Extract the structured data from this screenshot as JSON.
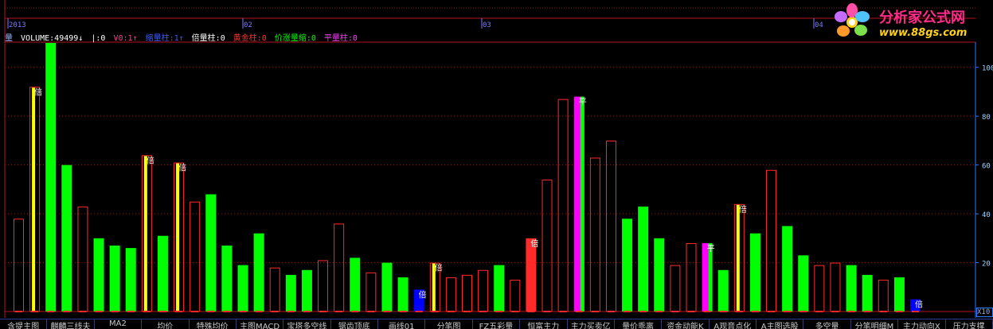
{
  "timeline": [
    {
      "label": "2013"
    },
    {
      "label": "02"
    },
    {
      "label": "03"
    },
    {
      "label": "04"
    }
  ],
  "indicator": {
    "name": "量",
    "volume": "VOLUME:49499↓",
    "sep": "|:0",
    "v0": "V0:1↑",
    "shrink": "缩量柱:1↑",
    "double": "倍量柱:0",
    "gold": "黄金柱:0",
    "rise_shrink": "价涨量缩:0",
    "flat": "平量柱:0"
  },
  "logo": {
    "title": "分析家公式网",
    "url": "www.88gs.com"
  },
  "scale_tag": "X10",
  "tabs": [
    "含提主图",
    "麒麟三线夫",
    "MA2",
    "均价",
    "特殊均价",
    "主图MACD",
    "宝塔多空线",
    "锯齿顶底",
    "画线01",
    "分笔图",
    "FZ五彩量",
    "恒富主力",
    "主力买卖亿",
    "量价乖离",
    "资金动能K",
    "A观音点化",
    "A主图选股",
    "多空量",
    "分笔明细M",
    "主力动向X",
    "压力支撑"
  ],
  "colors": {
    "up": "#ff2a2a",
    "down": "#00ff00",
    "double": "#ffff00",
    "gold": "#ff2a2a",
    "shrink": "#0000ff",
    "flat": "#ff00ff",
    "axis": "#b4141e",
    "grid": "#7a1a1a"
  },
  "chart_data": {
    "type": "bar",
    "title": "",
    "ylabel": "",
    "ylim": [
      0,
      110
    ],
    "yticks": [
      20,
      40,
      60,
      80,
      100
    ],
    "markers": {
      "double": "倍",
      "flat": "平"
    },
    "bars": [
      {
        "v": 38,
        "t": "up"
      },
      {
        "v": 92,
        "t": "double",
        "m": "double"
      },
      {
        "v": 115,
        "t": "down"
      },
      {
        "v": 60,
        "t": "down"
      },
      {
        "v": 43,
        "t": "up"
      },
      {
        "v": 30,
        "t": "down"
      },
      {
        "v": 27,
        "t": "down"
      },
      {
        "v": 26,
        "t": "down"
      },
      {
        "v": 64,
        "t": "double",
        "m": "double"
      },
      {
        "v": 31,
        "t": "down"
      },
      {
        "v": 61,
        "t": "double",
        "m": "double"
      },
      {
        "v": 45,
        "t": "up"
      },
      {
        "v": 48,
        "t": "down"
      },
      {
        "v": 27,
        "t": "down"
      },
      {
        "v": 19,
        "t": "down"
      },
      {
        "v": 32,
        "t": "down"
      },
      {
        "v": 18,
        "t": "up"
      },
      {
        "v": 15,
        "t": "down"
      },
      {
        "v": 17,
        "t": "down"
      },
      {
        "v": 21,
        "t": "up"
      },
      {
        "v": 36,
        "t": "up"
      },
      {
        "v": 22,
        "t": "down"
      },
      {
        "v": 16,
        "t": "up"
      },
      {
        "v": 20,
        "t": "down"
      },
      {
        "v": 14,
        "t": "down"
      },
      {
        "v": 9,
        "t": "shrink",
        "m": "double"
      },
      {
        "v": 20,
        "t": "double",
        "m": "double"
      },
      {
        "v": 14,
        "t": "up"
      },
      {
        "v": 15,
        "t": "up"
      },
      {
        "v": 17,
        "t": "up"
      },
      {
        "v": 19,
        "t": "down"
      },
      {
        "v": 13,
        "t": "up"
      },
      {
        "v": 30,
        "t": "gold",
        "m": "double"
      },
      {
        "v": 54,
        "t": "up"
      },
      {
        "v": 87,
        "t": "up"
      },
      {
        "v": 88,
        "t": "flat",
        "m": "flat"
      },
      {
        "v": 63,
        "t": "up"
      },
      {
        "v": 70,
        "t": "up"
      },
      {
        "v": 38,
        "t": "down"
      },
      {
        "v": 43,
        "t": "down"
      },
      {
        "v": 30,
        "t": "down"
      },
      {
        "v": 19,
        "t": "up"
      },
      {
        "v": 28,
        "t": "up"
      },
      {
        "v": 28,
        "t": "flat",
        "m": "flat"
      },
      {
        "v": 17,
        "t": "down"
      },
      {
        "v": 44,
        "t": "double",
        "m": "double"
      },
      {
        "v": 32,
        "t": "down"
      },
      {
        "v": 58,
        "t": "up"
      },
      {
        "v": 35,
        "t": "down"
      },
      {
        "v": 23,
        "t": "down"
      },
      {
        "v": 19,
        "t": "up"
      },
      {
        "v": 20,
        "t": "up"
      },
      {
        "v": 19,
        "t": "down"
      },
      {
        "v": 15,
        "t": "down"
      },
      {
        "v": 13,
        "t": "up"
      },
      {
        "v": 14,
        "t": "down"
      },
      {
        "v": 5,
        "t": "shrink",
        "m": "double"
      }
    ]
  }
}
